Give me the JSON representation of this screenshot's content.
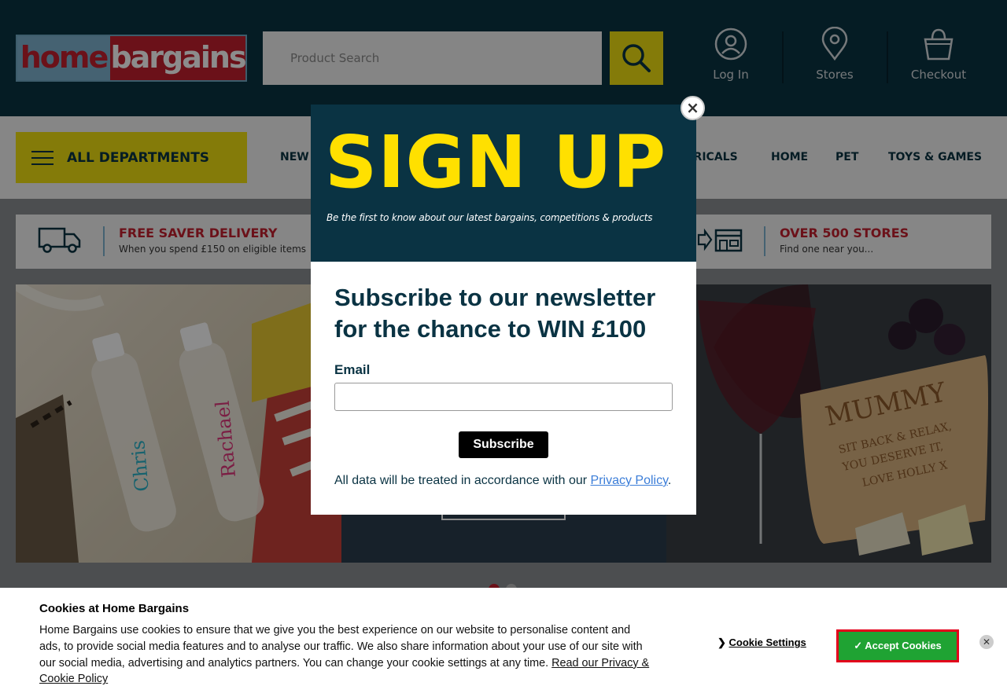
{
  "header": {
    "logo_home": "home",
    "logo_bargains": "bargains",
    "search_placeholder": "Product Search",
    "links": {
      "login": "Log In",
      "stores": "Stores",
      "checkout": "Checkout"
    }
  },
  "nav": {
    "all_departments": "ALL DEPARTMENTS",
    "items": [
      "NEW",
      "TRICALS",
      "HOME",
      "PET",
      "TOYS & GAMES"
    ]
  },
  "usp": {
    "delivery_title": "FREE SAVER DELIVERY",
    "delivery_sub": "When you spend £150 on eligible items",
    "stores_title": "OVER 500 STORES",
    "stores_sub": "Find one near you..."
  },
  "banner": {
    "left_names": [
      "Rachael",
      "Chris"
    ],
    "right_text": [
      "MUMMY",
      "SIT BACK & RELAX,",
      "YOU DESERVE IT,",
      "LOVE HOLLY X"
    ]
  },
  "modal": {
    "headline": "SIGN UP",
    "tagline": "Be the first to know about our latest bargains, competitions & products",
    "subscribe_heading": "Subscribe to our newsletter for the chance to WIN £100",
    "email_label": "Email",
    "subscribe_button": "Subscribe",
    "privacy_prefix": "All data will be treated in accordance with our",
    "privacy_link": "Privacy Policy",
    "privacy_suffix": ".",
    "close": "×"
  },
  "cookies": {
    "title": "Cookies at Home Bargains",
    "text": "Home Bargains use cookies to ensure that we give you the best experience on our website to personalise content and ads, to provide social media features and to analyse our traffic. We also share information about your use of our site with our social media, advertising and analytics partners. You can change your cookie settings at any time.",
    "read_link": "Read our Privacy & Cookie Policy",
    "settings_arrow": "❯",
    "settings": "Cookie Settings",
    "accept": "✓ Accept Cookies",
    "close": "✕"
  },
  "colors": {
    "header_bg": "#0a3343",
    "accent_yellow": "#f0e012",
    "brand_red": "#c41f2f",
    "accept_green": "#1fa333"
  },
  "carousel": {
    "slides": 2,
    "active": 1
  }
}
